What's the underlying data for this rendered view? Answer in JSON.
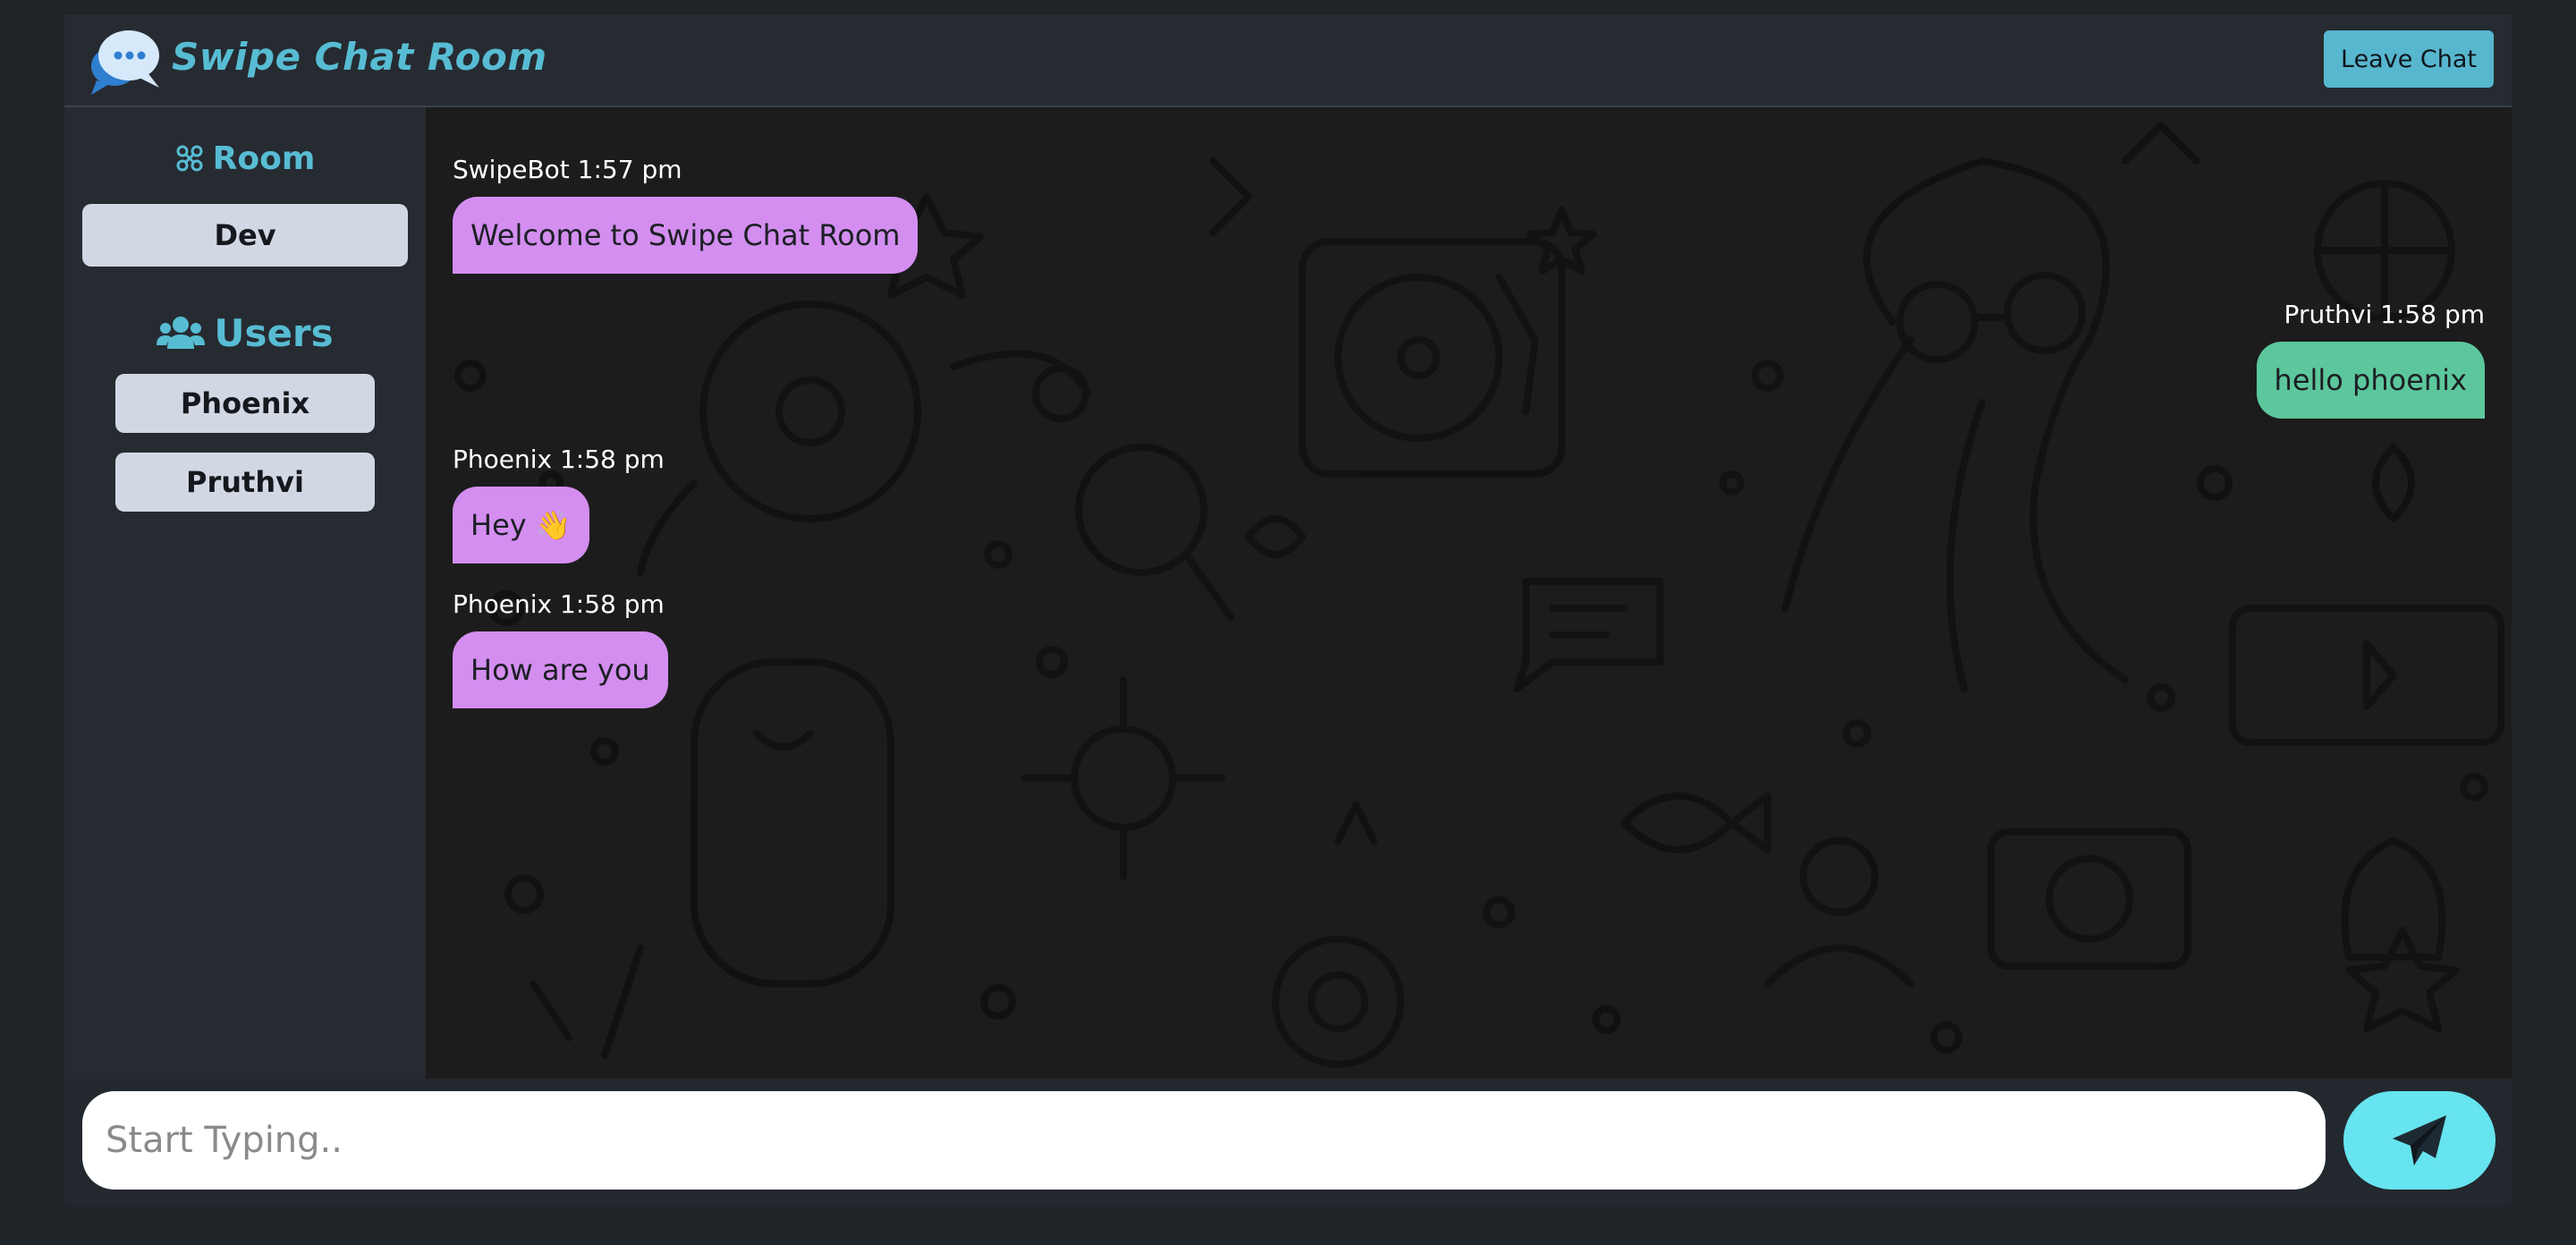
{
  "app": {
    "title": "Swipe Chat Room",
    "leave_label": "Leave Chat",
    "accent": "#57bcd3"
  },
  "sidebar": {
    "room_heading": "Room",
    "room_icon": "room-icon",
    "room_name": "Dev",
    "users_heading": "Users",
    "users_icon": "users-icon",
    "users": [
      "Phoenix",
      "Pruthvi"
    ]
  },
  "messages": [
    {
      "meta": "SwipeBot 1:57 pm",
      "text": "Welcome to Swipe Chat Room",
      "side": "in",
      "color": "#d38ef0"
    },
    {
      "meta": "Pruthvi 1:58 pm",
      "text": "hello phoenix",
      "side": "out",
      "color": "#5cc79c"
    },
    {
      "meta": "Phoenix 1:58 pm",
      "text": "Hey 👋",
      "side": "in",
      "color": "#d38ef0"
    },
    {
      "meta": "Phoenix 1:58 pm",
      "text": "How are you",
      "side": "in",
      "color": "#d38ef0"
    }
  ],
  "composer": {
    "placeholder": "Start Typing..",
    "value": "",
    "send_icon": "paper-plane-icon",
    "send_color": "#66e4ef"
  }
}
